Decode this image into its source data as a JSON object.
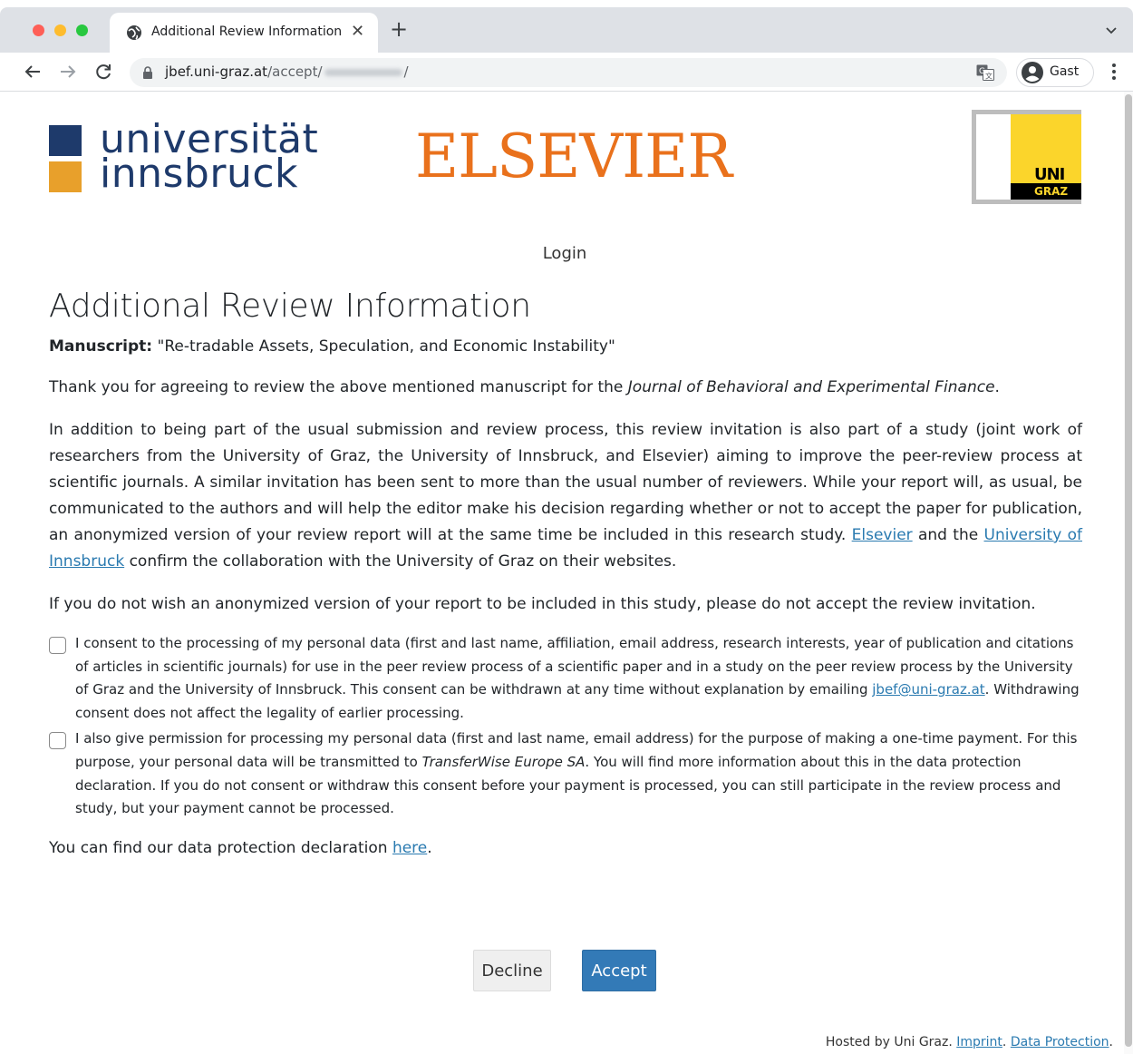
{
  "browser": {
    "tab_title": "Additional Review Information",
    "url_host": "jbef.uni-graz.at",
    "url_path_prefix": "/accept/",
    "url_path_suffix": "/",
    "profile_name": "Gast",
    "icons": [
      "globe-icon",
      "close-icon",
      "plus-icon",
      "chevron-down-icon",
      "back-arrow-icon",
      "forward-arrow-icon",
      "reload-icon",
      "lock-icon",
      "translate-icon",
      "account-icon",
      "kebab-menu-icon"
    ]
  },
  "logos": {
    "innsbruck_line1": "universität",
    "innsbruck_line2": "innsbruck",
    "elsevier": "ELSEVIER",
    "unigraz_top": "UNI",
    "unigraz_bottom": "GRAZ"
  },
  "nav": {
    "login": "Login"
  },
  "main": {
    "title": "Additional Review Information",
    "manuscript_label": "Manuscript:",
    "manuscript_title": "\"Re-tradable Assets, Speculation, and Economic Instability\"",
    "thanks_pre": "Thank you for agreeing to review the above mentioned manuscript for the ",
    "thanks_journal": "Journal of Behavioral and Experimental Finance",
    "thanks_post": ".",
    "study_pre": "In addition to being part of the usual submission and review process, this review invitation is also part of a study (joint work of researchers from the University of Graz, the University of Innsbruck, and Elsevier) aiming to improve the peer-review process at scientific journals. A similar invitation has been sent to more than the usual number of reviewers. While your report will, as usual, be communicated to the authors and will help the editor make his decision regarding whether or not to accept the paper for publication, an anonymized version of your review report will at the same time be included in this research study. ",
    "study_link1": "Elsevier",
    "study_mid": " and the ",
    "study_link2": "University of Innsbruck",
    "study_post": " confirm the collaboration with the University of Graz on their websites.",
    "optout": "If you do not wish an anonymized version of your report to be included in this study, please do not accept the review invitation.",
    "consent1_pre": "I consent to the processing of my personal data (first and last name, affiliation, email address, research interests, year of publication and citations of articles in scientific journals) for use in the peer review process of a scientific paper and in a study on the peer review process by the University of Graz and the University of Innsbruck. This consent can be withdrawn at any time without explanation by emailing ",
    "consent1_email": "jbef@uni-graz.at",
    "consent1_post": ". Withdrawing consent does not affect the legality of earlier processing.",
    "consent1_checked": false,
    "consent2_pre": "I also give permission for processing my personal data (first and last name, email address) for the purpose of making a one-time payment. For this purpose, your personal data will be transmitted to ",
    "consent2_company": "TransferWise Europe SA",
    "consent2_post": ". You will find more information about this in the data protection declaration. If you do not consent or withdraw this consent before your payment is processed, you can still participate in the review process and study, but your payment cannot be processed.",
    "consent2_checked": false,
    "dp_pre": "You can find our data protection declaration ",
    "dp_link": "here",
    "dp_post": ".",
    "decline_label": "Decline",
    "accept_label": "Accept"
  },
  "footer": {
    "hosted": "Hosted by Uni Graz. ",
    "imprint": "Imprint",
    "sep": ". ",
    "data_protection": "Data Protection",
    "end": "."
  },
  "colors": {
    "link": "#2a7ab0",
    "accept_button": "#337ab7",
    "elsevier_orange": "#e9711c",
    "innsbruck_blue": "#1e3a6b",
    "innsbruck_orange": "#e8a02b",
    "unigraz_yellow": "#fbd52b"
  }
}
